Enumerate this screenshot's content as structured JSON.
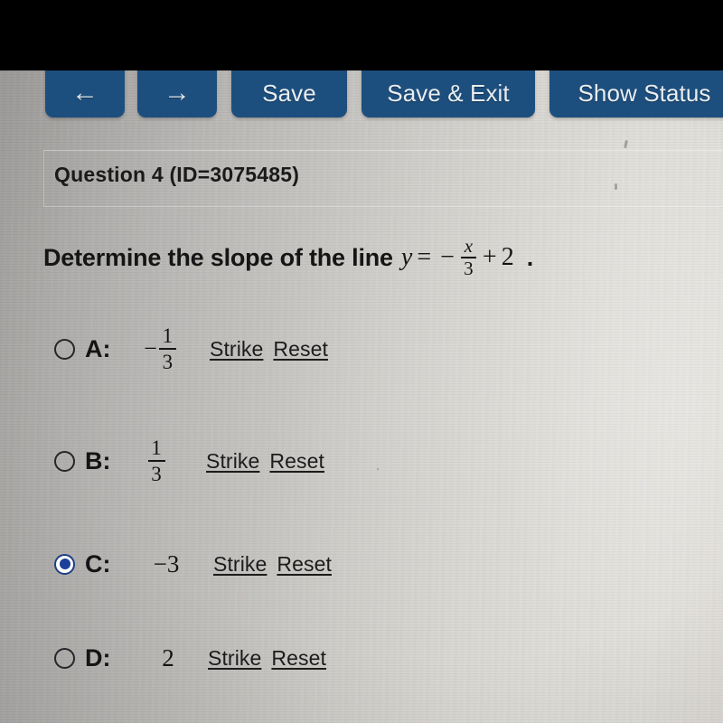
{
  "toolbar": {
    "back_label": "←",
    "back_name": "arrow-left-icon",
    "forward_label": "→",
    "forward_name": "arrow-right-icon",
    "save_label": "Save",
    "save_exit_label": "Save & Exit",
    "show_status_label": "Show Status",
    "button_color": "#1d4f7e",
    "button_text_color": "#e9edf1"
  },
  "question": {
    "header": "Question 4 (ID=3075485)",
    "prompt_text": "Determine the slope of the line",
    "equation": {
      "lhs": "y",
      "equals": "=",
      "sign": "−",
      "fraction_numerator": "x",
      "fraction_denominator": "3",
      "plus": "+",
      "constant": "2"
    },
    "period": "."
  },
  "options": [
    {
      "letter": "A:",
      "selected": false,
      "value_type": "fraction",
      "negative": "−",
      "numerator": "1",
      "denominator": "3",
      "value_plain": "-1/3",
      "strike_label": "Strike",
      "reset_label": "Reset"
    },
    {
      "letter": "B:",
      "selected": false,
      "value_type": "fraction",
      "negative": "",
      "numerator": "1",
      "denominator": "3",
      "value_plain": "1/3",
      "strike_label": "Strike",
      "reset_label": "Reset"
    },
    {
      "letter": "C:",
      "selected": true,
      "value_type": "plain",
      "value_plain": "−3",
      "strike_label": "Strike",
      "reset_label": "Reset"
    },
    {
      "letter": "D:",
      "selected": false,
      "value_type": "plain",
      "value_plain": "2",
      "strike_label": "Strike",
      "reset_label": "Reset"
    }
  ],
  "theme": {
    "selected_radio_color": "#1d3f99",
    "page_background": "#c2c0bc",
    "letterbox_color": "#000000"
  }
}
